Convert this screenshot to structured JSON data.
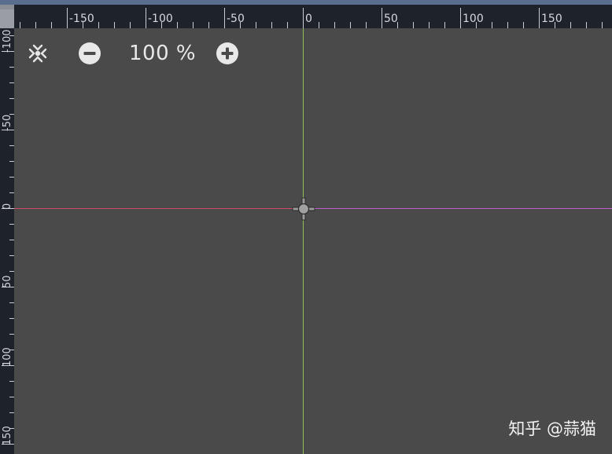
{
  "toolbar": {
    "center_icon": "center-view-icon",
    "zoom_out_icon": "zoom-out-icon",
    "zoom_label": "100 %",
    "zoom_in_icon": "zoom-in-icon"
  },
  "ruler_top": {
    "labels": [
      "-150",
      "-100",
      "-50",
      "0",
      "50",
      "100",
      "150"
    ]
  },
  "ruler_left": {
    "labels": [
      "-100",
      "-50",
      "0",
      "50",
      "100",
      "150"
    ]
  },
  "origin_gizmo_icon": "origin-gizmo-icon",
  "watermark": "知乎 @蒜猫",
  "colors": {
    "canvas": "#4a4a4a",
    "ruler": "#1e222a",
    "y_axis": "#8fbf55",
    "x_axis_left": "#d04a66",
    "x_axis_right": "#c25cc8",
    "top_bar": "#5a6e90"
  }
}
